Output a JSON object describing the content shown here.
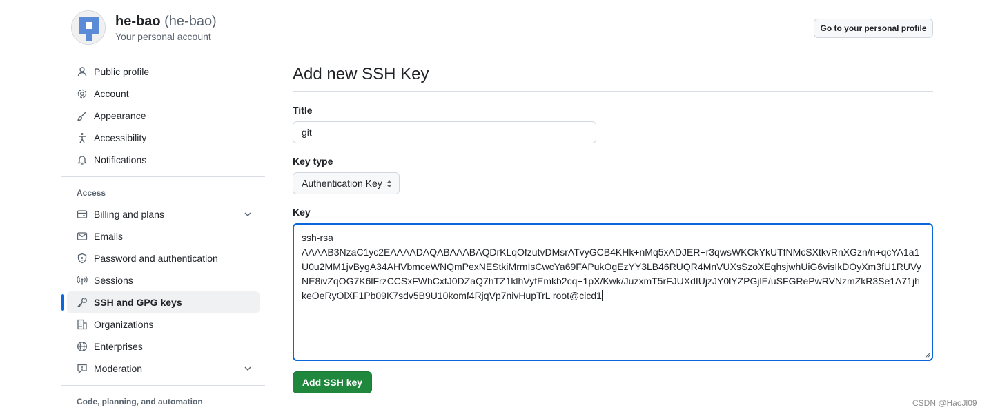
{
  "header": {
    "username": "he-bao",
    "handle": "(he-bao)",
    "subtitle": "Your personal account",
    "profile_button": "Go to your personal profile"
  },
  "sidebar": {
    "top_items": [
      {
        "label": "Public profile",
        "icon": "person-icon"
      },
      {
        "label": "Account",
        "icon": "gear-icon"
      },
      {
        "label": "Appearance",
        "icon": "paintbrush-icon"
      },
      {
        "label": "Accessibility",
        "icon": "accessibility-icon"
      },
      {
        "label": "Notifications",
        "icon": "bell-icon"
      }
    ],
    "access_label": "Access",
    "access_items": [
      {
        "label": "Billing and plans",
        "icon": "credit-card-icon",
        "expandable": true
      },
      {
        "label": "Emails",
        "icon": "mail-icon"
      },
      {
        "label": "Password and authentication",
        "icon": "shield-lock-icon"
      },
      {
        "label": "Sessions",
        "icon": "broadcast-icon"
      },
      {
        "label": "SSH and GPG keys",
        "icon": "key-icon",
        "active": true
      },
      {
        "label": "Organizations",
        "icon": "organization-icon"
      },
      {
        "label": "Enterprises",
        "icon": "globe-icon"
      },
      {
        "label": "Moderation",
        "icon": "report-icon",
        "expandable": true
      }
    ],
    "code_label": "Code, planning, and automation"
  },
  "main": {
    "title": "Add new SSH Key",
    "title_label": "Title",
    "title_value": "git",
    "type_label": "Key type",
    "type_value": "Authentication Key",
    "key_label": "Key",
    "key_value": "ssh-rsa\nAAAAB3NzaC1yc2EAAAADAQABAAABAQDrKLqOfzutvDMsrATvyGCB4KHk+nMq5xADJER+r3qwsWKCkYkUTfNMcSXtkvRnXGzn/n+qcYA1a1U0u2MM1jvBygA34AHVbmceWNQmPexNEStkiMrmIsCwcYa69FAPukOgEzYY3LB46RUQR4MnVUXsSzoXEqhsjwhUiG6visIkDOyXm3fU1RUVyNE8ivZqOG7K6lFrzCCSxFWhCxtJ0DZaQ7hTZ1klhVyfEmkb2cq+1pX/Kwk/JuzxmT5rFJUXdIUjzJY0lYZPGjlE/uSFGRePwRVNzmZkR3Se1A71jhkeOeRyOlXF1Pb09K7sdv5B9U10komf4RjqVp7nivHupTrL root@cicd1",
    "submit_label": "Add SSH key"
  },
  "watermark": "CSDN @HaoJl09",
  "colors": {
    "accent": "#0969da",
    "primary_button": "#1f883d",
    "muted_text": "#59636e",
    "border": "#d0d7de"
  }
}
